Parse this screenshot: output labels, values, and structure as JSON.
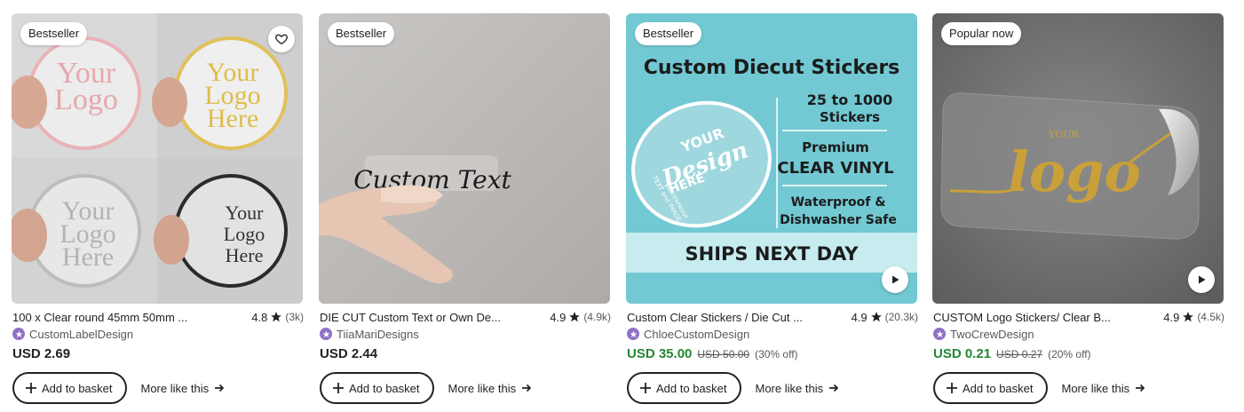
{
  "colors": {
    "sale_green": "#258635",
    "text": "#222222",
    "muted": "#595959",
    "shop_badge": "#8f72c7",
    "teal": "#72c9d3"
  },
  "listings": [
    {
      "badge": "Bestseller",
      "has_favorite": true,
      "has_play": false,
      "image_text": {
        "c1": [
          "Your",
          "Logo"
        ],
        "c2": [
          "Your",
          "Logo",
          "Here"
        ],
        "c3": [
          "Your",
          "Logo",
          "Here"
        ],
        "c4": [
          "Your",
          "Logo",
          "Here"
        ]
      },
      "title": "100 x Clear round 45mm 50mm ...",
      "rating": "4.8",
      "reviews": "(3k)",
      "shop": "CustomLabelDesign",
      "price": "USD 2.69",
      "original_price": "",
      "discount": "",
      "basket_label": "Add to basket",
      "more_label": "More like this"
    },
    {
      "badge": "Bestseller",
      "has_favorite": false,
      "has_play": false,
      "image_text": {
        "script": "Custom Text"
      },
      "title": "DIE CUT Custom Text or Own De...",
      "rating": "4.9",
      "reviews": "(4.9k)",
      "shop": "TiiaMariDesigns",
      "price": "USD 2.44",
      "original_price": "",
      "discount": "",
      "basket_label": "Add to basket",
      "more_label": "More like this"
    },
    {
      "badge": "Bestseller",
      "has_favorite": false,
      "has_play": true,
      "image_text": {
        "headline": "Custom Diecut Stickers",
        "range1": "25 to 1000",
        "range2": "Stickers",
        "prem1": "Premium",
        "prem2": "CLEAR VINYL",
        "water1": "Waterproof &",
        "water2": "Dishwasher Safe",
        "ships": "SHIPS NEXT DAY",
        "sticker1": "YOUR",
        "sticker2": "Design",
        "sticker3": "HERE",
        "sticker4": "TEXT and IMAGE",
        "sticker5": "WATERPROOF"
      },
      "title": "Custom Clear Stickers / Die Cut ...",
      "rating": "4.9",
      "reviews": "(20.3k)",
      "shop": "ChloeCustomDesign",
      "price": "USD 35.00",
      "original_price": "USD 50.00",
      "discount": "(30% off)",
      "basket_label": "Add to basket",
      "more_label": "More like this"
    },
    {
      "badge": "Popular now",
      "has_favorite": false,
      "has_play": true,
      "image_text": {
        "small": "YOUR",
        "script": "logo"
      },
      "title": "CUSTOM Logo Stickers/ Clear B...",
      "rating": "4.9",
      "reviews": "(4.5k)",
      "shop": "TwoCrewDesign",
      "price": "USD 0.21",
      "original_price": "USD 0.27",
      "discount": "(20% off)",
      "basket_label": "Add to basket",
      "more_label": "More like this"
    }
  ]
}
